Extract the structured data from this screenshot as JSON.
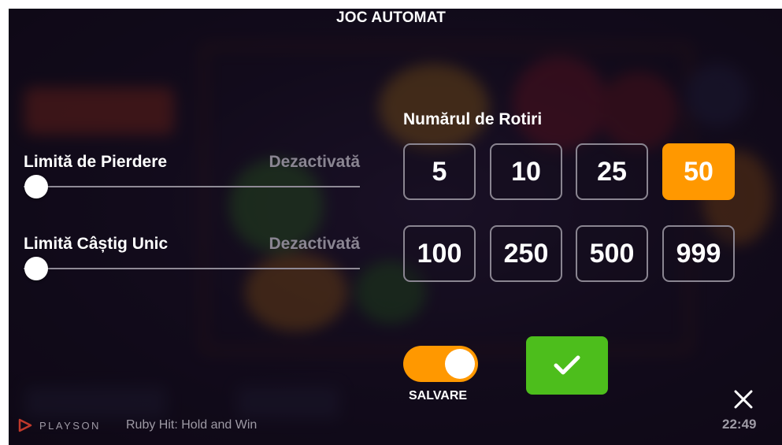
{
  "dialog": {
    "title": "JOC AUTOMAT"
  },
  "loss_limit": {
    "label": "Limită de Pierdere",
    "value": "Dezactivată",
    "level": 0
  },
  "single_win_limit": {
    "label": "Limită Câștig Unic",
    "value": "Dezactivată",
    "level": 0
  },
  "spins": {
    "title": "Numărul de Rotiri",
    "options": [
      "5",
      "10",
      "25",
      "50",
      "100",
      "250",
      "500",
      "999"
    ],
    "selected": "50"
  },
  "save_toggle": {
    "label": "SALVARE",
    "on": true
  },
  "confirm": {
    "icon": "checkmark-icon"
  },
  "close": {
    "icon": "close-icon"
  },
  "footer": {
    "brand": "PLAYSON",
    "game_name": "Ruby Hit: Hold and Win",
    "time": "22:49"
  },
  "colors": {
    "accent": "#ff9800",
    "confirm": "#4dbe1c",
    "text": "#ffffff",
    "muted": "#8a8592"
  }
}
